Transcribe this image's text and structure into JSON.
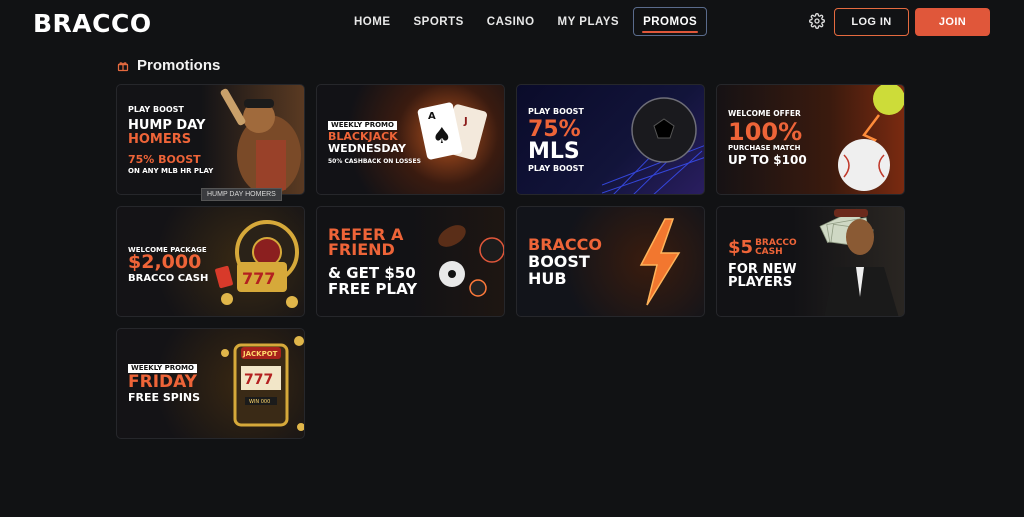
{
  "header": {
    "logo": "BRACCO",
    "nav": [
      {
        "label": "HOME"
      },
      {
        "label": "SPORTS"
      },
      {
        "label": "CASINO"
      },
      {
        "label": "MY PLAYS"
      },
      {
        "label": "PROMOS",
        "active": true
      }
    ],
    "login_label": "LOG IN",
    "join_label": "JOIN"
  },
  "section": {
    "title": "Promotions"
  },
  "cards": [
    {
      "tag": "PLAY BOOST",
      "line1": "HUMP DAY",
      "line2": "HOMERS",
      "line3": "75% BOOST",
      "line4": "ON ANY MLB HR PLAY",
      "tooltip": "HUMP DAY HOMERS"
    },
    {
      "tag": "WEEKLY PROMO",
      "line1": "BLACKJACK",
      "line2": "WEDNESDAY",
      "line3": "50% CASHBACK ON LOSSES"
    },
    {
      "tag": "PLAY BOOST",
      "line1": "75%",
      "line2": "MLS",
      "line3": "PLAY BOOST"
    },
    {
      "tag": "WELCOME OFFER",
      "line1": "100%",
      "line2": "PURCHASE MATCH",
      "line3": "UP TO $100"
    },
    {
      "tag": "WELCOME PACKAGE",
      "line1": "$2,000",
      "line2": "BRACCO CASH"
    },
    {
      "line1": "REFER A",
      "line2": "FRIEND",
      "line3": "& GET $50",
      "line4": "FREE PLAY"
    },
    {
      "line1": "BRACCO",
      "line2": "BOOST",
      "line3": "HUB"
    },
    {
      "line1": "$5",
      "line1b": "BRACCO",
      "line1c": "CASH",
      "line2": "FOR NEW",
      "line3": "PLAYERS"
    },
    {
      "tag": "WEEKLY PROMO",
      "line1": "FRIDAY",
      "line2": "FREE SPINS",
      "slot_top": "JACKPOT",
      "slot_bottom": "WIN 000"
    }
  ],
  "colors": {
    "background": "#111214",
    "accent": "#e0573a",
    "active_nav_border": "#5a6b8c"
  },
  "icons": [
    "gear-icon",
    "gift-icon"
  ]
}
